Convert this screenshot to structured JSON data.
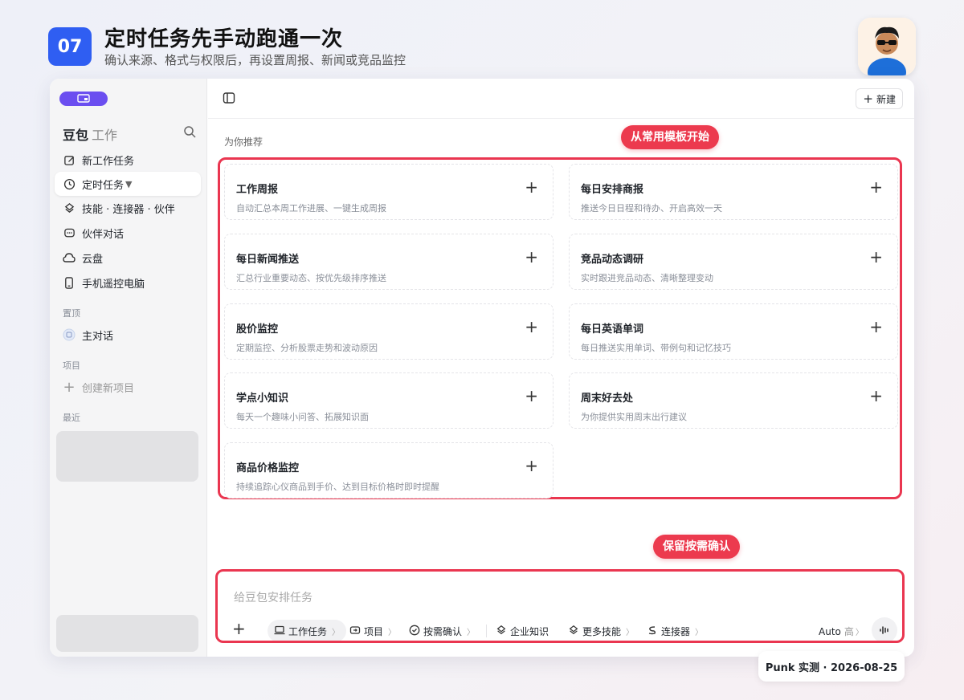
{
  "header": {
    "step": "07",
    "title": "定时任务先手动跑通一次",
    "subtitle": "确认来源、格式与权限后，再设置周报、新闻或竞品监控"
  },
  "sidebar": {
    "brand": "豆包",
    "brand_suffix": "工作",
    "items": [
      {
        "label": "新工作任务",
        "icon": "edit-icon"
      },
      {
        "label": "定时任务",
        "icon": "clock-icon"
      },
      {
        "label": "技能 · 连接器 · 伙伴",
        "icon": "layers-icon"
      },
      {
        "label": "伙伴对话",
        "icon": "chat-icon"
      },
      {
        "label": "云盘",
        "icon": "cloud-icon"
      },
      {
        "label": "手机遥控电脑",
        "icon": "phone-icon"
      }
    ],
    "pinned_label": "置顶",
    "pinned_item": "主对话",
    "project_label": "项目",
    "create_project": "创建新项目",
    "recent_label": "最近"
  },
  "topbar": {
    "new_label": "新建"
  },
  "main": {
    "recommend_label": "为你推荐",
    "tag_templates": "从常用模板开始",
    "tag_confirm": "保留按需确认",
    "cards": [
      {
        "title": "工作周报",
        "desc": "自动汇总本周工作进展、一键生成周报"
      },
      {
        "title": "每日安排商报",
        "desc": "推送今日日程和待办、开启高效一天"
      },
      {
        "title": "每日新闻推送",
        "desc": "汇总行业重要动态、按优先级排序推送"
      },
      {
        "title": "竞品动态调研",
        "desc": "实时跟进竞品动态、清晰整理变动"
      },
      {
        "title": "股价监控",
        "desc": "定期监控、分析股票走势和波动原因"
      },
      {
        "title": "每日英语单词",
        "desc": "每日推送实用单词、带例句和记忆技巧"
      },
      {
        "title": "学点小知识",
        "desc": "每天一个趣味小问答、拓展知识面"
      },
      {
        "title": "周末好去处",
        "desc": "为你提供实用周末出行建议"
      },
      {
        "title": "商品价格监控",
        "desc": "持续追踪心仪商品到手价、达到目标价格时即时提醒"
      }
    ],
    "card_plus": "+"
  },
  "composer": {
    "placeholder": "给豆包安排任务",
    "plus": "+",
    "work_task": "工作任务",
    "project": "项目",
    "confirm": "按需确认",
    "knowledge": "企业知识",
    "more_skills": "更多技能",
    "connector": "连接器",
    "model": "Auto",
    "level": "高"
  },
  "footer": {
    "text": "Punk 实测 · 2026-08-25"
  },
  "colors": {
    "accent_blue": "#2f5ef2",
    "accent_red": "#ea3650",
    "brand_purple": "#6b4ef0"
  }
}
